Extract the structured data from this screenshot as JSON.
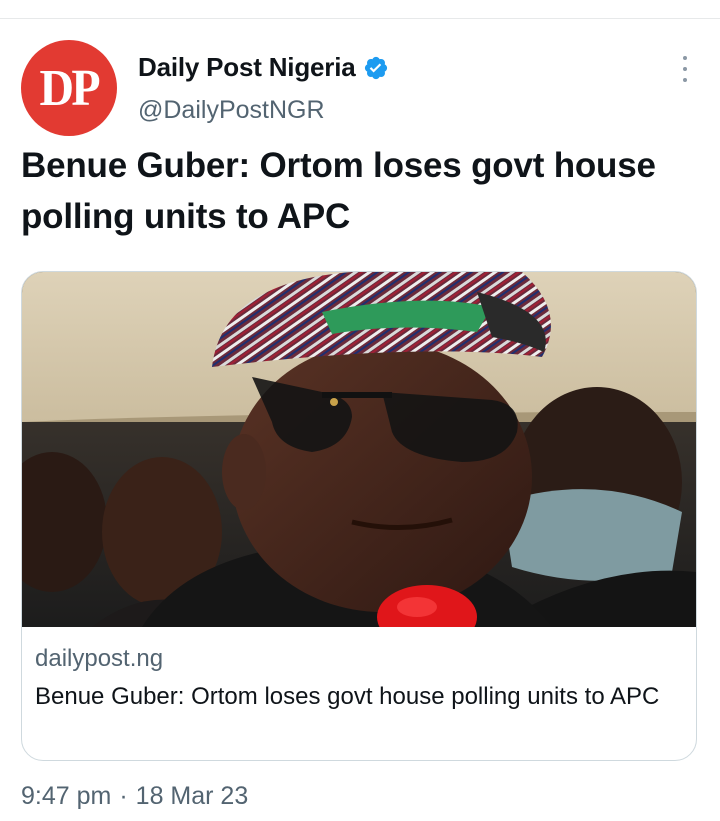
{
  "tweet": {
    "avatar_text": "DP",
    "display_name": "Daily Post Nigeria",
    "handle": "@DailyPostNGR",
    "verified": true,
    "text": "Benue Guber: Ortom loses govt house polling units to APC",
    "time": "9:47 pm",
    "separator": "·",
    "date": "18 Mar 23"
  },
  "card": {
    "domain": "dailypost.ng",
    "title": "Benue Guber: Ortom loses govt house polling units to APC"
  },
  "icons": {
    "verified": "verified-badge-icon",
    "more": "more-options-icon"
  },
  "colors": {
    "avatar_bg": "#e23a32",
    "verified": "#1d9bf0",
    "secondary_text": "#536471",
    "border": "#cfd9de"
  }
}
